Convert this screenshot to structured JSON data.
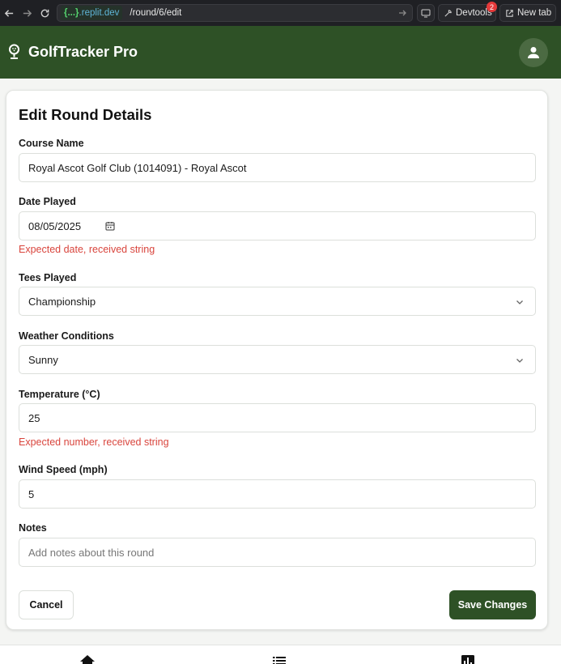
{
  "browser": {
    "domain_badge": "{...}",
    "domain": ".replit.dev",
    "path": "/round/6/edit",
    "devtools_label": "Devtools",
    "devtools_badge": "2",
    "newtab_label": "New tab"
  },
  "header": {
    "app_title": "GolfTracker Pro",
    "colors": {
      "brand": "#2e5126"
    }
  },
  "form": {
    "title": "Edit Round Details",
    "course": {
      "label": "Course Name",
      "value": "Royal Ascot Golf Club (1014091) - Royal Ascot"
    },
    "date": {
      "label": "Date Played",
      "value": "08/05/2025",
      "error": "Expected date, received string"
    },
    "tees": {
      "label": "Tees Played",
      "value": "Championship"
    },
    "weather": {
      "label": "Weather Conditions",
      "value": "Sunny"
    },
    "temperature": {
      "label": "Temperature (°C)",
      "value": "25",
      "error": "Expected number, received string"
    },
    "wind": {
      "label": "Wind Speed (mph)",
      "value": "5"
    },
    "notes": {
      "label": "Notes",
      "placeholder": "Add notes about this round"
    },
    "cancel_label": "Cancel",
    "save_label": "Save Changes"
  },
  "icons": [
    "back-icon",
    "forward-icon",
    "reload-icon",
    "calendar-icon",
    "chevron-down-icon",
    "user-icon",
    "golf-pin-icon",
    "home-icon",
    "list-icon",
    "chart-icon"
  ],
  "colors": {
    "error": "#d9453d",
    "brand": "#2e5126"
  }
}
